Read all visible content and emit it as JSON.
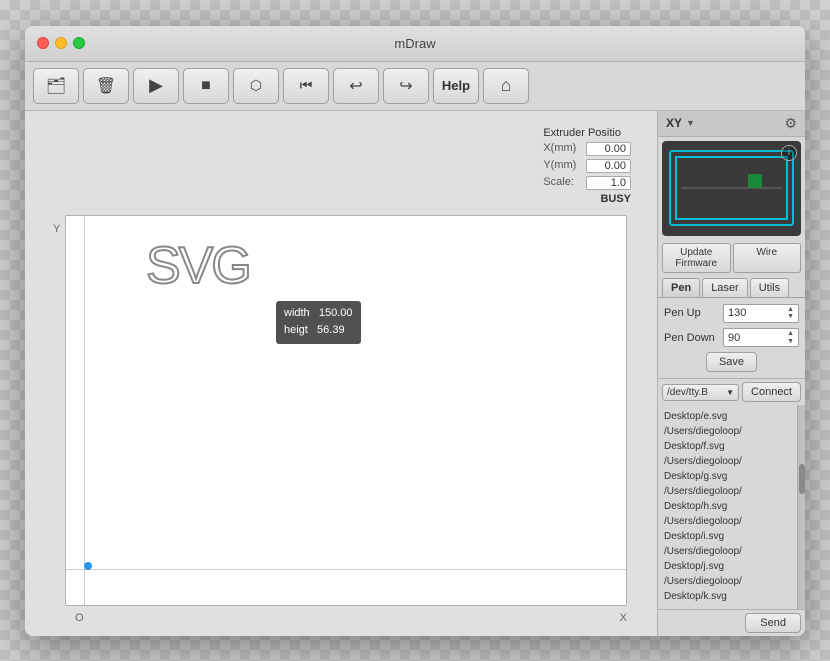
{
  "window": {
    "title": "mDraw"
  },
  "toolbar": {
    "buttons": [
      {
        "id": "folder",
        "icon": "📁",
        "label": "Open"
      },
      {
        "id": "trash",
        "icon": "🗑",
        "label": "Delete"
      },
      {
        "id": "play",
        "icon": "▶",
        "label": "Play"
      },
      {
        "id": "stop",
        "icon": "■",
        "label": "Stop"
      },
      {
        "id": "scan",
        "icon": "⬡",
        "label": "Scan"
      },
      {
        "id": "skip",
        "icon": "⏮",
        "label": "Skip"
      },
      {
        "id": "undo",
        "icon": "↩",
        "label": "Undo"
      },
      {
        "id": "redo",
        "icon": "↪",
        "label": "Redo"
      },
      {
        "id": "help",
        "icon": "Help",
        "label": "Help"
      },
      {
        "id": "home",
        "icon": "⌂",
        "label": "Home"
      }
    ]
  },
  "right_panel": {
    "dropdown_label": "XY",
    "tabs": [
      "Pen",
      "Laser",
      "Utils"
    ],
    "active_tab": "Pen",
    "pen_up_label": "Pen Up",
    "pen_up_value": "130",
    "pen_down_label": "Pen Down",
    "pen_down_value": "90",
    "save_label": "Save",
    "update_firmware_label": "Update Firmware",
    "wire_label": "Wire",
    "connect_label": "Connect",
    "send_label": "Send",
    "port_label": "/dev/tty.B"
  },
  "extruder": {
    "title": "Extruder Positio",
    "x_label": "X(mm)",
    "x_value": "0.00",
    "y_label": "Y(mm)",
    "y_value": "0.00",
    "scale_label": "Scale:",
    "scale_value": "1.0",
    "status": "BUSY"
  },
  "canvas": {
    "label_y": "Y",
    "label_x": "X",
    "label_o": "O",
    "svg_text": "SVG",
    "width_label": "width",
    "width_value": "150.00",
    "height_label": "heigt",
    "height_value": "56.39"
  },
  "log": {
    "entries": [
      "Desktop/e.svg",
      "/Users/diegoloop/",
      "Desktop/f.svg",
      "/Users/diegoloop/",
      "Desktop/g.svg",
      "/Users/diegoloop/",
      "Desktop/h.svg",
      "/Users/diegoloop/",
      "Desktop/i.svg",
      "/Users/diegoloop/",
      "Desktop/j.svg",
      "/Users/diegoloop/",
      "Desktop/k.svg"
    ]
  }
}
